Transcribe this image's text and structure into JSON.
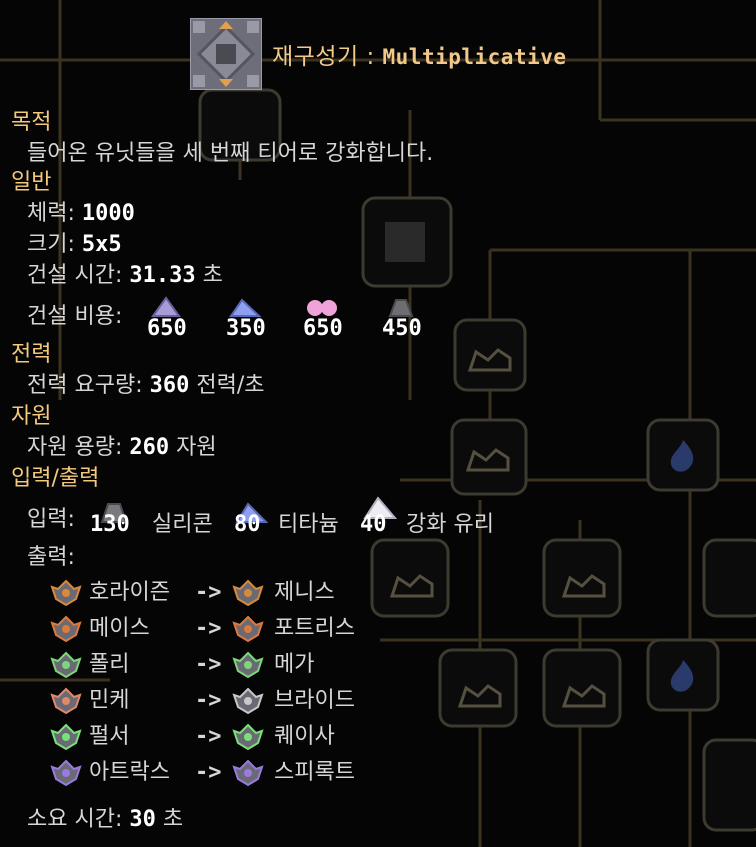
{
  "header": {
    "title_kr": "재구성기 : ",
    "title_en": "Multiplicative",
    "icon": "reconstructor-block-icon"
  },
  "purpose": {
    "heading": "목적",
    "text": "들어온 유닛들을 세 번째 티어로 강화합니다."
  },
  "general": {
    "heading": "일반",
    "health_label": "체력:",
    "health_value": "1000",
    "size_label": "크기:",
    "size_value": "5x5",
    "build_time_label": "건설 시간:",
    "build_time_value": "31.33",
    "build_time_unit": "초",
    "build_cost_label": "건설 비용:",
    "build_cost": [
      {
        "item": "lead",
        "color": "#a89bd6",
        "amount": "650"
      },
      {
        "item": "titanium",
        "color": "#8e9ff0",
        "amount": "350"
      },
      {
        "item": "thorium",
        "color": "#f0a3d8",
        "amount": "650"
      },
      {
        "item": "silicon",
        "color": "#6d6d72",
        "amount": "450"
      }
    ]
  },
  "power": {
    "heading": "전력",
    "use_label": "전력 요구량:",
    "use_value": "360",
    "use_unit": "전력/초"
  },
  "liquids": {
    "heading": "자원",
    "capacity_label": "자원 용량:",
    "capacity_value": "260",
    "capacity_unit": "자원"
  },
  "io": {
    "heading": "입력/출력",
    "input_label": "입력:",
    "inputs": [
      {
        "item": "silicon",
        "color": "#7a7a7e",
        "amount": "130",
        "label": "실리콘"
      },
      {
        "item": "titanium",
        "color": "#8e9ff0",
        "amount": "80",
        "label": "티타늄"
      },
      {
        "item": "plastanium",
        "color": "#e8e8f0",
        "amount": "40",
        "label": "강화 유리"
      }
    ],
    "output_label": "출력:",
    "arrow": "->",
    "upgrades": [
      {
        "from": "호라이즌",
        "to": "제니스",
        "from_color": "#d88a3a",
        "to_color": "#d88a3a"
      },
      {
        "from": "메이스",
        "to": "포트리스",
        "from_color": "#e07a3a",
        "to_color": "#e07a3a"
      },
      {
        "from": "폴리",
        "to": "메가",
        "from_color": "#7ed67a",
        "to_color": "#7ed67a"
      },
      {
        "from": "민케",
        "to": "브라이드",
        "from_color": "#e08a6a",
        "to_color": "#c8c8c8"
      },
      {
        "from": "펄서",
        "to": "퀘이사",
        "from_color": "#7ae07a",
        "to_color": "#7ae07a"
      },
      {
        "from": "아트락스",
        "to": "스피록트",
        "from_color": "#9a7ae0",
        "to_color": "#9a7ae0"
      }
    ],
    "time_label": "소요 시간:",
    "time_value": "30",
    "time_unit": "초"
  }
}
